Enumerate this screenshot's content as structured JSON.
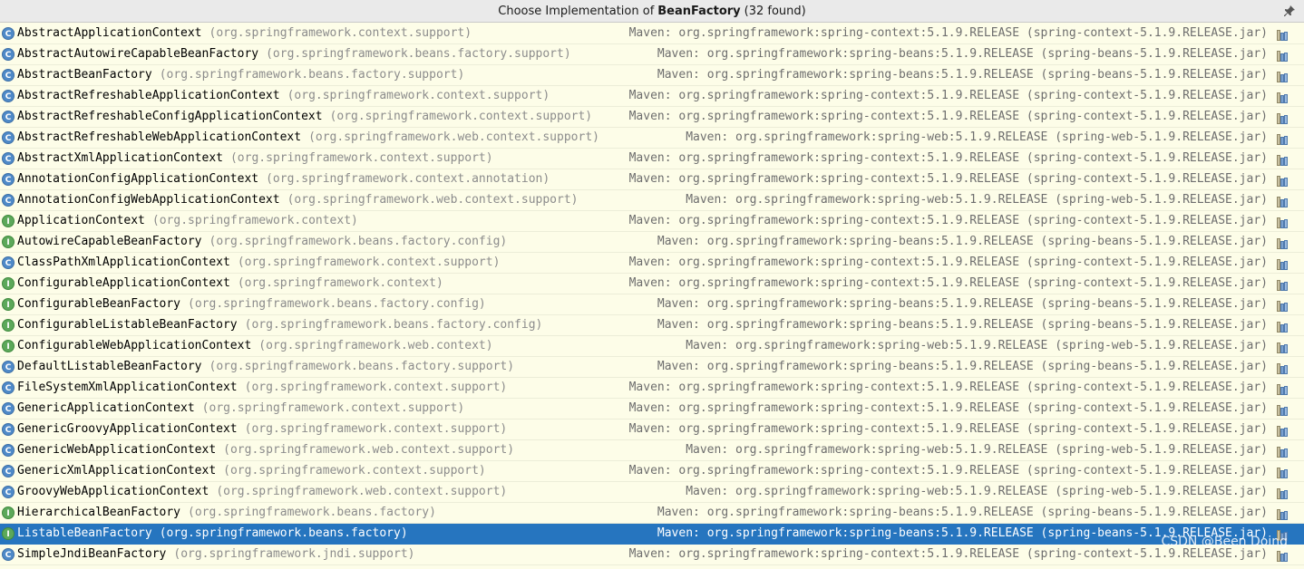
{
  "title": {
    "prefix": "Choose Implementation of",
    "target": "BeanFactory",
    "count": "(32 found)"
  },
  "icons": {
    "pin": "pin-icon",
    "class": "class-icon",
    "interface": "interface-icon",
    "jar": "jar-icon"
  },
  "colors": {
    "class_icon": "#4f8ac8",
    "interface_icon": "#5ca85a",
    "selection": "#2675bf",
    "background": "#fdfde8"
  },
  "items": [
    {
      "kind": "C",
      "name": "AbstractApplicationContext",
      "pkg": "(org.springframework.context.support)",
      "source": "Maven: org.springframework:spring-context:5.1.9.RELEASE (spring-context-5.1.9.RELEASE.jar)"
    },
    {
      "kind": "C",
      "name": "AbstractAutowireCapableBeanFactory",
      "pkg": "(org.springframework.beans.factory.support)",
      "source": "Maven: org.springframework:spring-beans:5.1.9.RELEASE (spring-beans-5.1.9.RELEASE.jar)"
    },
    {
      "kind": "C",
      "name": "AbstractBeanFactory",
      "pkg": "(org.springframework.beans.factory.support)",
      "source": "Maven: org.springframework:spring-beans:5.1.9.RELEASE (spring-beans-5.1.9.RELEASE.jar)"
    },
    {
      "kind": "C",
      "name": "AbstractRefreshableApplicationContext",
      "pkg": "(org.springframework.context.support)",
      "source": "Maven: org.springframework:spring-context:5.1.9.RELEASE (spring-context-5.1.9.RELEASE.jar)"
    },
    {
      "kind": "C",
      "name": "AbstractRefreshableConfigApplicationContext",
      "pkg": "(org.springframework.context.support)",
      "source": "Maven: org.springframework:spring-context:5.1.9.RELEASE (spring-context-5.1.9.RELEASE.jar)"
    },
    {
      "kind": "C",
      "name": "AbstractRefreshableWebApplicationContext",
      "pkg": "(org.springframework.web.context.support)",
      "source": "Maven: org.springframework:spring-web:5.1.9.RELEASE (spring-web-5.1.9.RELEASE.jar)"
    },
    {
      "kind": "C",
      "name": "AbstractXmlApplicationContext",
      "pkg": "(org.springframework.context.support)",
      "source": "Maven: org.springframework:spring-context:5.1.9.RELEASE (spring-context-5.1.9.RELEASE.jar)"
    },
    {
      "kind": "C",
      "name": "AnnotationConfigApplicationContext",
      "pkg": "(org.springframework.context.annotation)",
      "source": "Maven: org.springframework:spring-context:5.1.9.RELEASE (spring-context-5.1.9.RELEASE.jar)"
    },
    {
      "kind": "C",
      "name": "AnnotationConfigWebApplicationContext",
      "pkg": "(org.springframework.web.context.support)",
      "source": "Maven: org.springframework:spring-web:5.1.9.RELEASE (spring-web-5.1.9.RELEASE.jar)"
    },
    {
      "kind": "I",
      "name": "ApplicationContext",
      "pkg": "(org.springframework.context)",
      "source": "Maven: org.springframework:spring-context:5.1.9.RELEASE (spring-context-5.1.9.RELEASE.jar)"
    },
    {
      "kind": "I",
      "name": "AutowireCapableBeanFactory",
      "pkg": "(org.springframework.beans.factory.config)",
      "source": "Maven: org.springframework:spring-beans:5.1.9.RELEASE (spring-beans-5.1.9.RELEASE.jar)"
    },
    {
      "kind": "C",
      "name": "ClassPathXmlApplicationContext",
      "pkg": "(org.springframework.context.support)",
      "source": "Maven: org.springframework:spring-context:5.1.9.RELEASE (spring-context-5.1.9.RELEASE.jar)"
    },
    {
      "kind": "I",
      "name": "ConfigurableApplicationContext",
      "pkg": "(org.springframework.context)",
      "source": "Maven: org.springframework:spring-context:5.1.9.RELEASE (spring-context-5.1.9.RELEASE.jar)"
    },
    {
      "kind": "I",
      "name": "ConfigurableBeanFactory",
      "pkg": "(org.springframework.beans.factory.config)",
      "source": "Maven: org.springframework:spring-beans:5.1.9.RELEASE (spring-beans-5.1.9.RELEASE.jar)"
    },
    {
      "kind": "I",
      "name": "ConfigurableListableBeanFactory",
      "pkg": "(org.springframework.beans.factory.config)",
      "source": "Maven: org.springframework:spring-beans:5.1.9.RELEASE (spring-beans-5.1.9.RELEASE.jar)"
    },
    {
      "kind": "I",
      "name": "ConfigurableWebApplicationContext",
      "pkg": "(org.springframework.web.context)",
      "source": "Maven: org.springframework:spring-web:5.1.9.RELEASE (spring-web-5.1.9.RELEASE.jar)"
    },
    {
      "kind": "C",
      "name": "DefaultListableBeanFactory",
      "pkg": "(org.springframework.beans.factory.support)",
      "source": "Maven: org.springframework:spring-beans:5.1.9.RELEASE (spring-beans-5.1.9.RELEASE.jar)"
    },
    {
      "kind": "C",
      "name": "FileSystemXmlApplicationContext",
      "pkg": "(org.springframework.context.support)",
      "source": "Maven: org.springframework:spring-context:5.1.9.RELEASE (spring-context-5.1.9.RELEASE.jar)"
    },
    {
      "kind": "C",
      "name": "GenericApplicationContext",
      "pkg": "(org.springframework.context.support)",
      "source": "Maven: org.springframework:spring-context:5.1.9.RELEASE (spring-context-5.1.9.RELEASE.jar)"
    },
    {
      "kind": "C",
      "name": "GenericGroovyApplicationContext",
      "pkg": "(org.springframework.context.support)",
      "source": "Maven: org.springframework:spring-context:5.1.9.RELEASE (spring-context-5.1.9.RELEASE.jar)"
    },
    {
      "kind": "C",
      "name": "GenericWebApplicationContext",
      "pkg": "(org.springframework.web.context.support)",
      "source": "Maven: org.springframework:spring-web:5.1.9.RELEASE (spring-web-5.1.9.RELEASE.jar)"
    },
    {
      "kind": "C",
      "name": "GenericXmlApplicationContext",
      "pkg": "(org.springframework.context.support)",
      "source": "Maven: org.springframework:spring-context:5.1.9.RELEASE (spring-context-5.1.9.RELEASE.jar)"
    },
    {
      "kind": "C",
      "name": "GroovyWebApplicationContext",
      "pkg": "(org.springframework.web.context.support)",
      "source": "Maven: org.springframework:spring-web:5.1.9.RELEASE (spring-web-5.1.9.RELEASE.jar)"
    },
    {
      "kind": "I",
      "name": "HierarchicalBeanFactory",
      "pkg": "(org.springframework.beans.factory)",
      "source": "Maven: org.springframework:spring-beans:5.1.9.RELEASE (spring-beans-5.1.9.RELEASE.jar)"
    },
    {
      "kind": "I",
      "name": "ListableBeanFactory",
      "pkg": "(org.springframework.beans.factory)",
      "source": "Maven: org.springframework:spring-beans:5.1.9.RELEASE (spring-beans-5.1.9.RELEASE.jar)",
      "selected": true
    },
    {
      "kind": "C",
      "name": "SimpleJndiBeanFactory",
      "pkg": "(org.springframework.jndi.support)",
      "source": "Maven: org.springframework:spring-context:5.1.9.RELEASE (spring-context-5.1.9.RELEASE.jar)"
    }
  ],
  "watermark": "CSDN @Been Doing"
}
